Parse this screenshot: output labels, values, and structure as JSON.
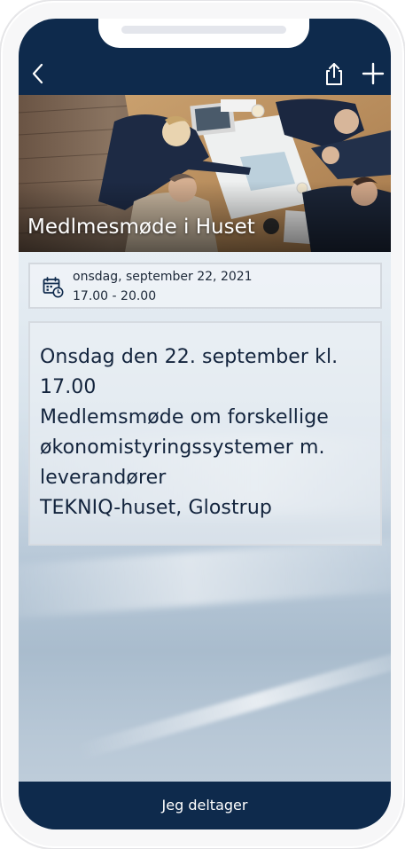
{
  "event": {
    "title": "Medlmesmøde i Huset",
    "date": "onsdag, september 22, 2021",
    "time": "17.00 - 20.00",
    "description_lines": [
      "Onsdag den 22. september kl.",
      "17.00",
      "Medlemsmøde om forskellige",
      "økonomistyringssystemer m.",
      "leverandører",
      "TEKNIQ-huset, Glostrup"
    ]
  },
  "actions": {
    "join_label": "Jeg deltager"
  },
  "icons": {
    "back": "chevron-left-icon",
    "share": "share-icon",
    "add": "plus-icon",
    "calendar": "calendar-clock-icon"
  },
  "colors": {
    "header": "#0e2a4c",
    "text": "#13243d"
  }
}
